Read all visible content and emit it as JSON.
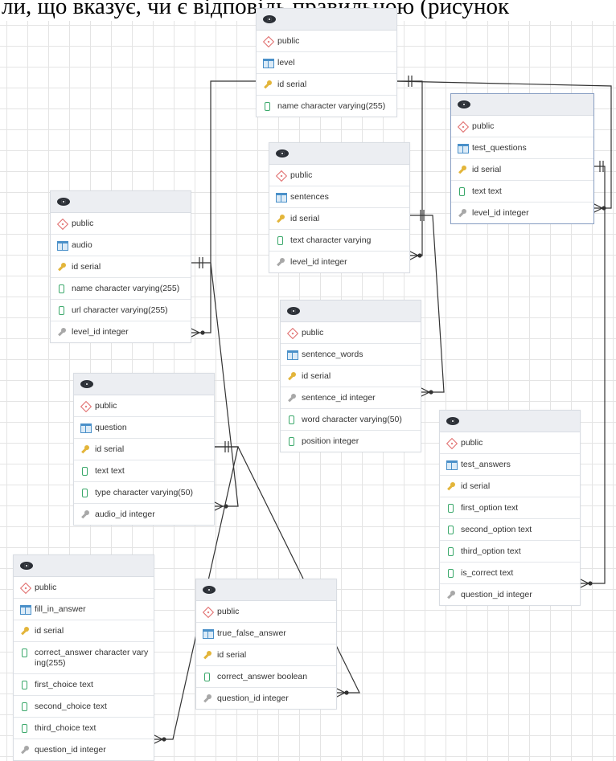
{
  "header_text": "ли, що вказує, чи є відповідь правильною (рисунок",
  "tables": [
    {
      "id": "level",
      "schema": "public",
      "name": "level",
      "columns": [
        {
          "text": "id serial",
          "kind": "pk"
        },
        {
          "text": "name character varying(255)",
          "kind": "col"
        }
      ]
    },
    {
      "id": "test_questions",
      "schema": "public",
      "name": "test_questions",
      "selected": true,
      "columns": [
        {
          "text": "id serial",
          "kind": "pk"
        },
        {
          "text": "text text",
          "kind": "col"
        },
        {
          "text": "level_id integer",
          "kind": "fk"
        }
      ]
    },
    {
      "id": "sentences",
      "schema": "public",
      "name": "sentences",
      "columns": [
        {
          "text": "id serial",
          "kind": "pk"
        },
        {
          "text": "text character varying",
          "kind": "col"
        },
        {
          "text": "level_id integer",
          "kind": "fk"
        }
      ]
    },
    {
      "id": "audio",
      "schema": "public",
      "name": "audio",
      "columns": [
        {
          "text": "id serial",
          "kind": "pk"
        },
        {
          "text": "name character varying(255)",
          "kind": "col"
        },
        {
          "text": "url character varying(255)",
          "kind": "col"
        },
        {
          "text": "level_id integer",
          "kind": "fk"
        }
      ]
    },
    {
      "id": "sentence_words",
      "schema": "public",
      "name": "sentence_words",
      "columns": [
        {
          "text": "id serial",
          "kind": "pk"
        },
        {
          "text": "sentence_id integer",
          "kind": "fk"
        },
        {
          "text": "word character varying(50)",
          "kind": "col"
        },
        {
          "text": "position integer",
          "kind": "col"
        }
      ]
    },
    {
      "id": "question",
      "schema": "public",
      "name": "question",
      "columns": [
        {
          "text": "id serial",
          "kind": "pk"
        },
        {
          "text": "text text",
          "kind": "col"
        },
        {
          "text": "type character varying(50)",
          "kind": "col"
        },
        {
          "text": "audio_id integer",
          "kind": "fk"
        }
      ]
    },
    {
      "id": "test_answers",
      "schema": "public",
      "name": "test_answers",
      "columns": [
        {
          "text": "id serial",
          "kind": "pk"
        },
        {
          "text": "first_option text",
          "kind": "col"
        },
        {
          "text": "second_option text",
          "kind": "col"
        },
        {
          "text": "third_option text",
          "kind": "col"
        },
        {
          "text": "is_correct text",
          "kind": "col"
        },
        {
          "text": "question_id integer",
          "kind": "fk"
        }
      ]
    },
    {
      "id": "fill_in_answer",
      "schema": "public",
      "name": "fill_in_answer",
      "columns": [
        {
          "text": "id serial",
          "kind": "pk"
        },
        {
          "text": "correct_answer character varying(255)",
          "kind": "col"
        },
        {
          "text": "first_choice text",
          "kind": "col"
        },
        {
          "text": "second_choice text",
          "kind": "col"
        },
        {
          "text": "third_choice text",
          "kind": "col"
        },
        {
          "text": "question_id integer",
          "kind": "fk"
        }
      ]
    },
    {
      "id": "true_false_answer",
      "schema": "public",
      "name": "true_false_answer",
      "columns": [
        {
          "text": "id serial",
          "kind": "pk"
        },
        {
          "text": "correct_answer boolean",
          "kind": "col"
        },
        {
          "text": "question_id integer",
          "kind": "fk"
        }
      ]
    }
  ]
}
